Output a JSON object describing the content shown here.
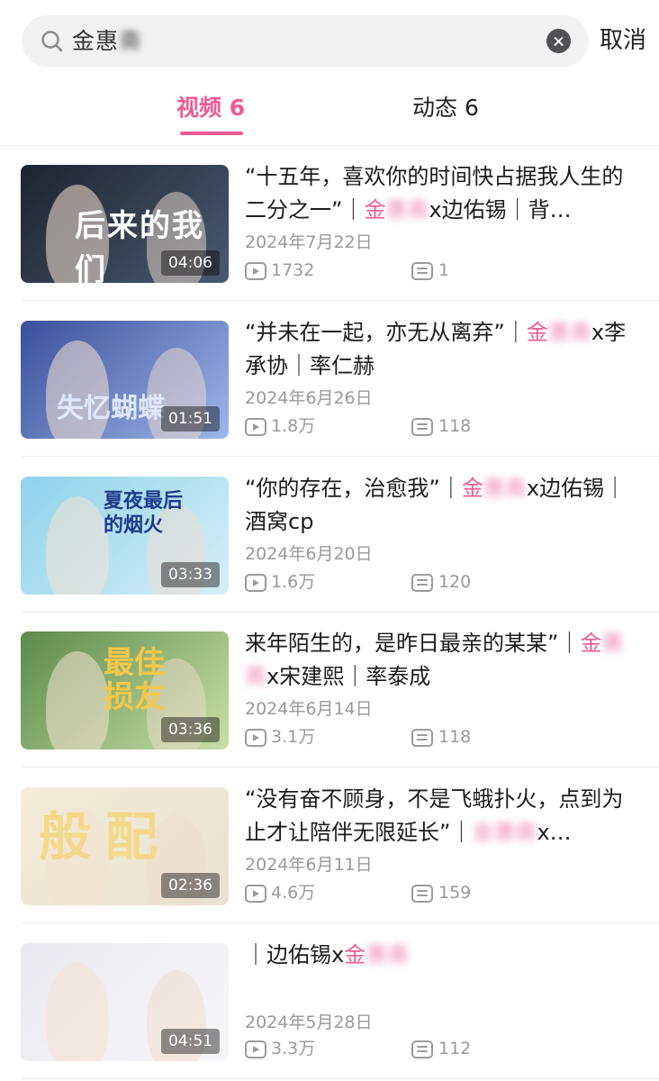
{
  "search": {
    "query_visible": "金惠",
    "query_blurred": "斋",
    "cancel_label": "取消"
  },
  "tabs": [
    {
      "label": "视频 6",
      "active": true
    },
    {
      "label": "动态 6",
      "active": false
    }
  ],
  "videos": [
    {
      "title_pre": "“十五年，喜欢你的时间快占据我人生的二分之一”｜",
      "title_name": "金",
      "title_blur": "惠斋",
      "title_post": "x边佑锡｜背…",
      "date": "2024年7月22日",
      "plays": "1732",
      "comments": "1",
      "duration": "04:06",
      "thumb_text": "后来的我们",
      "thumb_colors": [
        "#1d2430",
        "#4a5a6e"
      ]
    },
    {
      "title_pre": "“并未在一起，亦无从离弃”｜",
      "title_name": "金",
      "title_blur": "惠斋",
      "title_post": "x李承协｜率仁赫",
      "date": "2024年6月26日",
      "plays": "1.8万",
      "comments": "118",
      "duration": "01:51",
      "thumb_text": "失忆蝴蝶",
      "thumb_colors": [
        "#3a4f9a",
        "#9fb6e8"
      ]
    },
    {
      "title_pre": "“你的存在，治愈我”｜",
      "title_name": "金",
      "title_blur": "惠斋",
      "title_post": "x边佑锡｜酒窝cp",
      "date": "2024年6月20日",
      "plays": "1.6万",
      "comments": "120",
      "duration": "03:33",
      "thumb_text": "夏夜最后的烟火",
      "thumb_colors": [
        "#8fd3ec",
        "#d6eef5"
      ]
    },
    {
      "title_pre": "来年陌生的，是昨日最亲的某某”｜",
      "title_name": "金",
      "title_blur": "惠斋",
      "title_post": "x宋建熙｜率泰成",
      "date": "2024年6月14日",
      "plays": "3.1万",
      "comments": "118",
      "duration": "03:36",
      "thumb_text": "最佳损友",
      "thumb_colors": [
        "#5c8a4a",
        "#c9dfa8"
      ]
    },
    {
      "title_pre": "“没有奋不顾身，不是飞蛾扑火，点到为止才让陪伴无限延长”｜",
      "title_name": "",
      "title_blur": "金惠斋",
      "title_post": "x…",
      "date": "2024年6月11日",
      "plays": "4.6万",
      "comments": "159",
      "duration": "02:36",
      "thumb_text": "般配",
      "thumb_colors": [
        "#f4ecd8",
        "#e8e2d2"
      ]
    },
    {
      "title_pre": "｜边佑锡x",
      "title_name": "金",
      "title_blur": "惠斋",
      "title_post": "",
      "date": "2024年5月28日",
      "plays": "3.3万",
      "comments": "112",
      "duration": "04:51",
      "thumb_text": "",
      "thumb_colors": [
        "#e8e8ee",
        "#f7f7fa"
      ]
    }
  ]
}
